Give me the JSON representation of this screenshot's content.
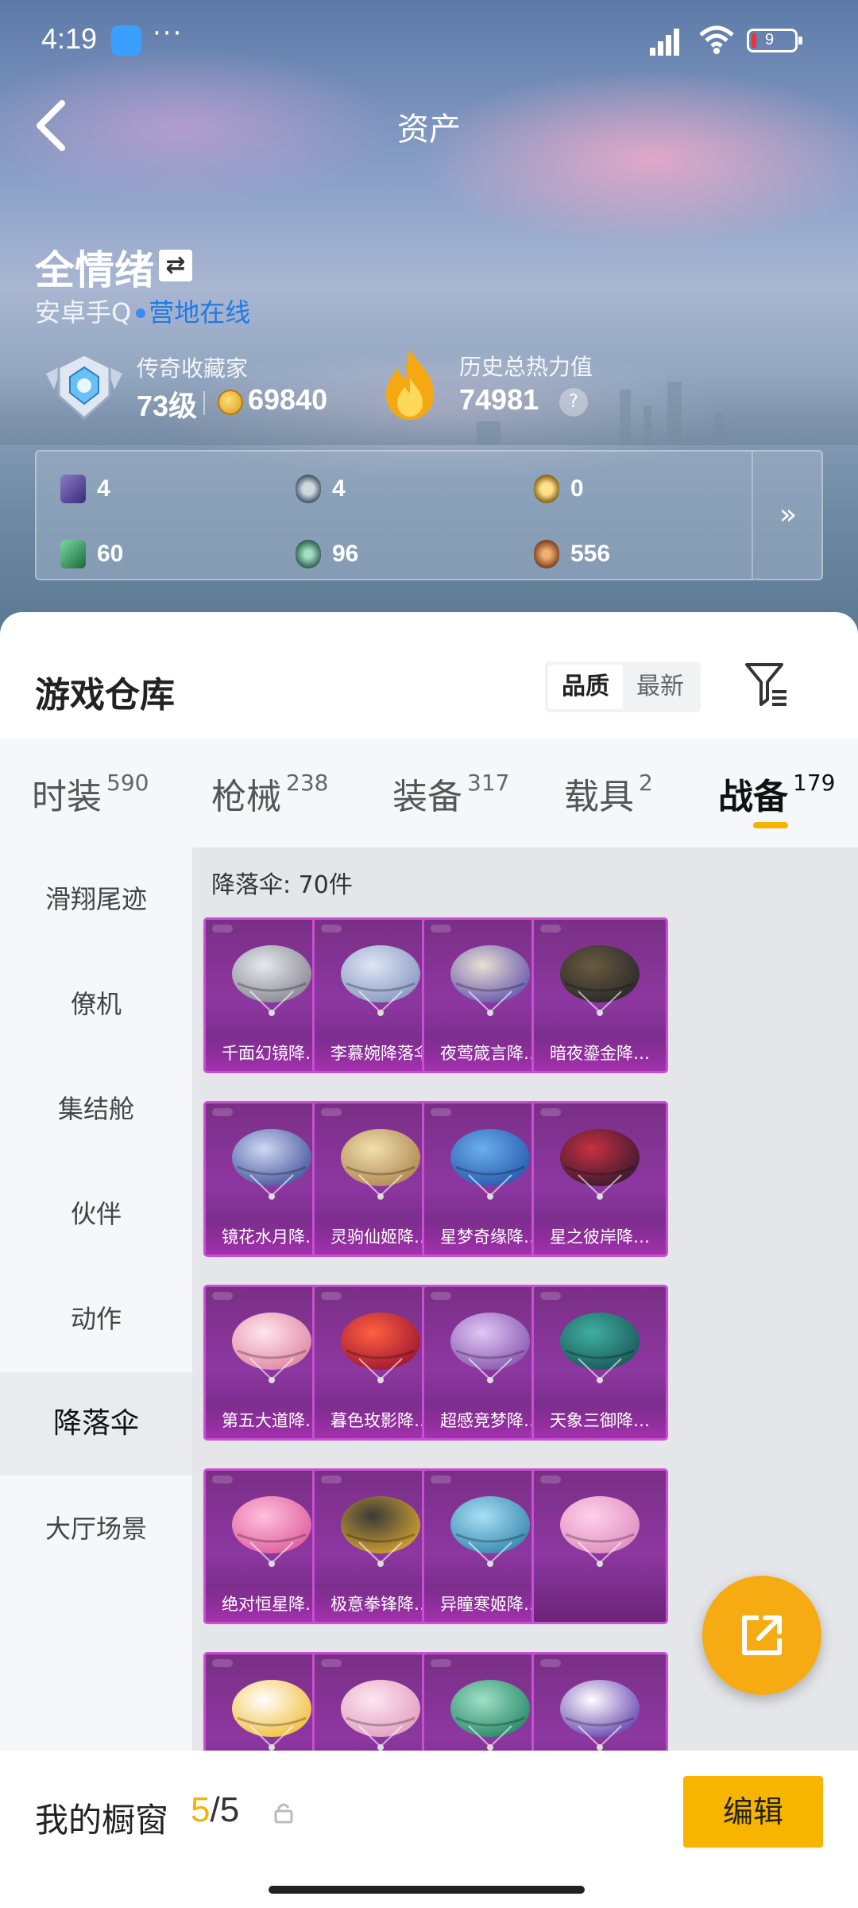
{
  "status_bar": {
    "time": "4:19",
    "more": "···",
    "battery": "9"
  },
  "nav": {
    "title": "资产"
  },
  "profile": {
    "username": "全情绪",
    "platform": "安卓手Q",
    "location": "营地在线",
    "rank_title": "传奇收藏家",
    "level": "73级",
    "coins": "69840",
    "heat_title": "历史总热力值",
    "heat_value": "74981",
    "help": "?"
  },
  "stats": [
    {
      "icon": "purple-card-icon",
      "value": "4",
      "color": "#5a4a9a"
    },
    {
      "icon": "silver-medal-icon",
      "value": "4",
      "color": "#6a7a8a"
    },
    {
      "icon": "gold-medal-icon",
      "value": "0",
      "color": "#b8952a"
    },
    {
      "icon": "green-card-icon",
      "value": "60",
      "color": "#2e8a5a"
    },
    {
      "icon": "green-orb-icon",
      "value": "96",
      "color": "#3b7a6a"
    },
    {
      "icon": "bronze-orb-icon",
      "value": "556",
      "color": "#b0602a"
    }
  ],
  "stats_expand": "»",
  "warehouse": {
    "title": "游戏仓库",
    "sort": [
      "品质",
      "最新"
    ],
    "sort_active": 0
  },
  "tabs": [
    {
      "label": "时装",
      "count": "590"
    },
    {
      "label": "枪械",
      "count": "238"
    },
    {
      "label": "装备",
      "count": "317"
    },
    {
      "label": "载具",
      "count": "2"
    },
    {
      "label": "战备",
      "count": "179"
    }
  ],
  "tab_active": 4,
  "sidebar": [
    "滑翔尾迹",
    "僚机",
    "集结舱",
    "伙伴",
    "动作",
    "降落伞",
    "大厅场景"
  ],
  "sidebar_active": 5,
  "grid": {
    "header": "降落伞: 70件",
    "items": [
      {
        "name": "千面幻镜降…",
        "c1": "#e8e8ee",
        "c2": "#8a8a96"
      },
      {
        "name": "李慕婉降落伞",
        "c1": "#dfe6f5",
        "c2": "#8a9ac2"
      },
      {
        "name": "夜莺箴言降…",
        "c1": "#e8e0d0",
        "c2": "#6a5ab0"
      },
      {
        "name": "暗夜鎏金降…",
        "c1": "#6a5a40",
        "c2": "#2a2a2a"
      },
      {
        "name": "镜花水月降…",
        "c1": "#cfd8f2",
        "c2": "#4a5aa0"
      },
      {
        "name": "灵驹仙姬降…",
        "c1": "#f2e0b0",
        "c2": "#b08a50"
      },
      {
        "name": "星梦奇缘降…",
        "c1": "#6ab0ea",
        "c2": "#2a5ab0"
      },
      {
        "name": "星之彼岸降…",
        "c1": "#c83040",
        "c2": "#3a1a30"
      },
      {
        "name": "第五大道降…",
        "c1": "#ffe6ee",
        "c2": "#e088a6"
      },
      {
        "name": "暮色玫影降…",
        "c1": "#ff6040",
        "c2": "#a01830"
      },
      {
        "name": "超感竞梦降…",
        "c1": "#e0c8f5",
        "c2": "#8a5ab0"
      },
      {
        "name": "天象三御降…",
        "c1": "#40b0a0",
        "c2": "#1a5a5a"
      },
      {
        "name": "绝对恒星降…",
        "c1": "#ffc0dc",
        "c2": "#e060a0"
      },
      {
        "name": "极意拳锋降…",
        "c1": "#3a3a3a",
        "c2": "#d0a030"
      },
      {
        "name": "异瞳寒姬降…",
        "c1": "#a8e0f5",
        "c2": "#3a8ab0"
      },
      {
        "name": "",
        "c1": "#ffd0ea",
        "c2": "#e090c0"
      },
      {
        "name": "",
        "c1": "#ffffff",
        "c2": "#f0c040"
      },
      {
        "name": "",
        "c1": "#ffe6f0",
        "c2": "#e0a0c0"
      },
      {
        "name": "",
        "c1": "#a0e0c8",
        "c2": "#2a8a6a"
      },
      {
        "name": "",
        "c1": "#ffffff",
        "c2": "#6a4ab0"
      }
    ]
  },
  "bottom": {
    "shelf_label": "我的橱窗",
    "current": "5",
    "separator": "/",
    "total": "5",
    "edit": "编辑"
  },
  "colors": {
    "accent": "#f5b400",
    "card_border": "#c84fd1",
    "link": "#1f7ae8"
  }
}
